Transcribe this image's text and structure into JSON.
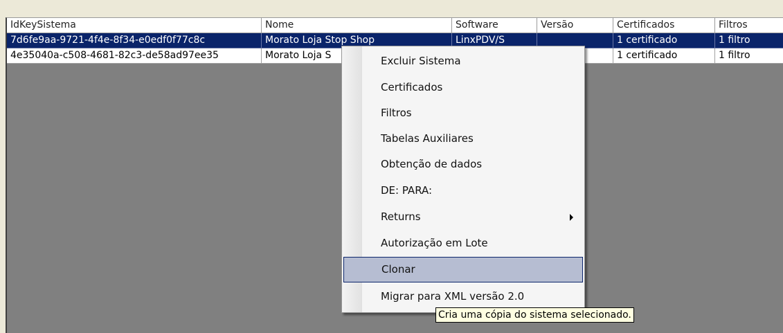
{
  "grid": {
    "columns": [
      "IdKeySistema",
      "Nome",
      "Software",
      "Versão",
      "Certificados",
      "Filtros"
    ],
    "rows": [
      {
        "id": "7d6fe9aa-9721-4f4e-8f34-e0edf0f77c8c",
        "nome": "Morato Loja Stop Shop",
        "software": "LinxPDV/S",
        "versao": "",
        "certificados": "1 certificado",
        "filtros": "1 filtro",
        "selected": true
      },
      {
        "id": "4e35040a-c508-4681-82c3-de58ad97ee35",
        "nome": "Morato Loja S",
        "software": "",
        "versao": "",
        "certificados": "1 certificado",
        "filtros": "1 filtro",
        "selected": false
      }
    ]
  },
  "context_menu": {
    "items": [
      "Excluir Sistema",
      "Certificados",
      "Filtros",
      "Tabelas Auxiliares",
      "Obtenção de dados",
      "DE: PARA:",
      "Returns",
      "Autorização em Lote",
      "Clonar",
      "Migrar para XML versão 2.0"
    ],
    "highlighted": "Clonar",
    "submenu_item": "Returns"
  },
  "tooltip": {
    "text": "Cria uma cópia do sistema selecionado."
  },
  "colors": {
    "selection": "#0a246a",
    "menu_hover": "#b6bdd2",
    "tooltip_bg": "#ffffe1",
    "grid_background": "#808080"
  }
}
